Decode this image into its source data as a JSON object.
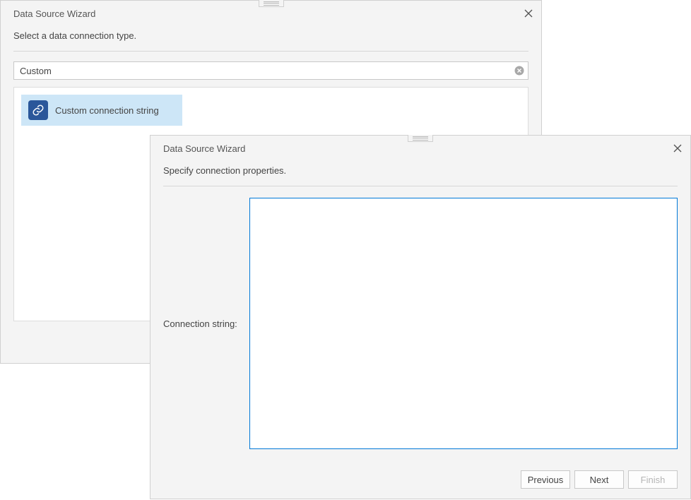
{
  "wizard_back": {
    "title": "Data Source Wizard",
    "subtitle": "Select a data connection type.",
    "search_value": "Custom",
    "items": [
      {
        "label": "Custom connection string"
      }
    ]
  },
  "wizard_front": {
    "title": "Data Source Wizard",
    "subtitle": "Specify connection properties.",
    "form": {
      "connection_label": "Connection string:",
      "connection_value": ""
    },
    "buttons": {
      "previous": "Previous",
      "next": "Next",
      "finish": "Finish"
    }
  }
}
